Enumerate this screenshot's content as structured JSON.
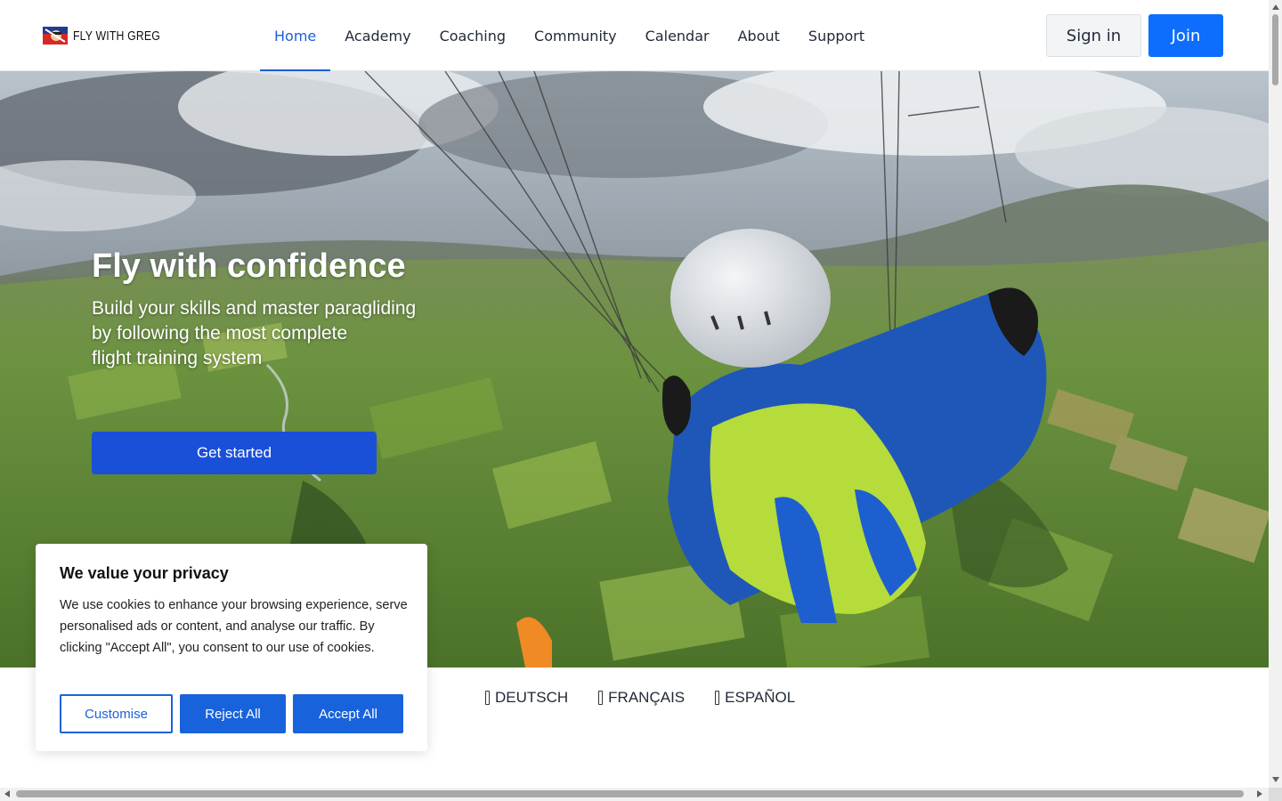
{
  "header": {
    "logo_text": "FLY WITH GREG",
    "nav": [
      {
        "label": "Home",
        "active": true
      },
      {
        "label": "Academy"
      },
      {
        "label": "Coaching"
      },
      {
        "label": "Community"
      },
      {
        "label": "Calendar"
      },
      {
        "label": "About"
      },
      {
        "label": "Support"
      }
    ],
    "signin_label": "Sign in",
    "join_label": "Join"
  },
  "hero": {
    "title": "Fly with confidence",
    "subtitle_lines": [
      "Build your skills and master paragliding",
      "by following the most complete",
      "flight training system"
    ],
    "cta_label": "Get started"
  },
  "languages": [
    {
      "label": "DEUTSCH"
    },
    {
      "label": "FRANÇAIS"
    },
    {
      "label": "ESPAÑOL"
    }
  ],
  "cookie_banner": {
    "title": "We value your privacy",
    "text": "We use cookies to enhance your browsing experience, serve personalised ads or content, and analyse our traffic. By clicking \"Accept All\", you consent to our use of cookies.",
    "customise_label": "Customise",
    "reject_label": "Reject All",
    "accept_label": "Accept All"
  },
  "colors": {
    "accent": "#0d6efd",
    "nav_active": "#1d5fd6",
    "cta": "#1a4fd8",
    "cookie_button": "#1863dc"
  }
}
